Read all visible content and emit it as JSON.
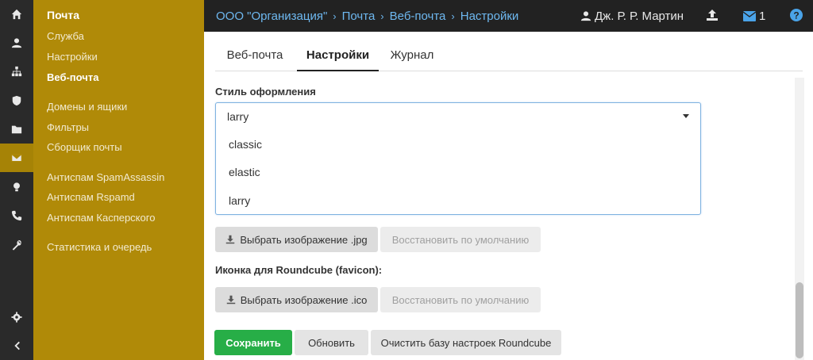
{
  "colors": {
    "rail": "#2a2a2a",
    "sidebar": "#b08a08",
    "accent_link": "#6eb8f0",
    "save_green": "#27ae47"
  },
  "rail_icons": [
    "home-icon",
    "user-icon",
    "sitemap-icon",
    "shield-icon",
    "folder-icon",
    "envelope-icon",
    "lightbulb-icon",
    "phone-icon",
    "wrench-icon",
    "gear-icon",
    "chevron-left-icon"
  ],
  "sidebar": {
    "title": "Почта",
    "items": [
      {
        "label": "Служба"
      },
      {
        "label": "Настройки"
      },
      {
        "label": "Веб-почта"
      },
      {
        "label": "Домены и ящики"
      },
      {
        "label": "Фильтры"
      },
      {
        "label": "Сборщик почты"
      },
      {
        "label": "Антиспам SpamAssassin"
      },
      {
        "label": "Антиспам Rspamd"
      },
      {
        "label": "Антиспам Касперского"
      },
      {
        "label": "Статистика и очередь"
      }
    ]
  },
  "header": {
    "breadcrumbs": [
      "ООО \"Организация\"",
      "Почта",
      "Веб-почта",
      "Настройки"
    ],
    "separator": "›",
    "user_name": "Дж. Р. Р. Мартин",
    "mail_count": "1"
  },
  "tabs": [
    {
      "label": "Веб-почта"
    },
    {
      "label": "Настройки"
    },
    {
      "label": "Журнал"
    }
  ],
  "form": {
    "style_label": "Стиль оформления",
    "style_value": "larry",
    "style_options": [
      "classic",
      "elastic",
      "larry"
    ],
    "pick_jpg_label": "Выбрать изображение .jpg",
    "restore_label_1": "Восстановить по умолчанию",
    "favicon_label": "Иконка для Roundcube (favicon):",
    "pick_ico_label": "Выбрать изображение .ico",
    "restore_label_2": "Восстановить по умолчанию"
  },
  "actions": {
    "save_label": "Сохранить",
    "refresh_label": "Обновить",
    "clear_label": "Очистить базу настроек Roundcube"
  }
}
